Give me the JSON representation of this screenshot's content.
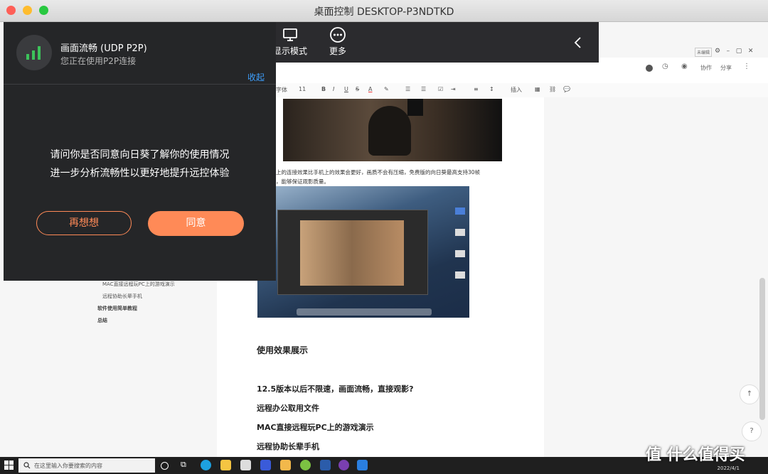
{
  "window": {
    "title": "桌面控制 DESKTOP-P3NDTKD"
  },
  "toolbar": {
    "display_mode_label": "显示模式",
    "more_label": "更多"
  },
  "popup": {
    "status_title": "画面流畅 (UDP P2P)",
    "status_subtitle": "您正在使用P2P连接",
    "collapse_label": "收起",
    "message_line1": "请问你是否同意向日葵了解你的使用情况",
    "message_line2": "进一步分析流畅性以更好地提升远控体验",
    "decline_label": "再想想",
    "accept_label": "同意"
  },
  "document": {
    "header": {
      "collab_label": "协作",
      "share_label": "分享",
      "corner_tag": "未编辑"
    },
    "format_bar": {
      "font_label": "字体",
      "size_label": "11",
      "insert_label": "插入"
    },
    "toc": [
      {
        "label": "MAC直接远程玩PC上的游戏演示",
        "bold": false
      },
      {
        "label": "远程协助长辈手机",
        "bold": false
      },
      {
        "label": "软件使用简单教程",
        "bold": true
      },
      {
        "label": "总结",
        "bold": true
      }
    ],
    "paragraph_line1": "上的连接效果比手机上的效果会更好，画质不会有压缩，免费版的向日葵最高支持30帧",
    "paragraph_line2": "，能够保证观影质量。",
    "headings": [
      "使用效果展示",
      "12.5版本以后不限速，画面流畅，直接观影?",
      "远程办公取用文件",
      "MAC直接远程玩PC上的游戏演示",
      "远程协助长辈手机"
    ]
  },
  "taskbar": {
    "search_placeholder": "在这里输入你要搜索的内容",
    "date": "2022/4/1"
  },
  "watermark": "值 什么值得买",
  "colors": {
    "accent_orange": "#ff8a57",
    "link_blue": "#3ea0ff",
    "signal_green": "#3cc35a",
    "popup_bg": "#252628"
  }
}
